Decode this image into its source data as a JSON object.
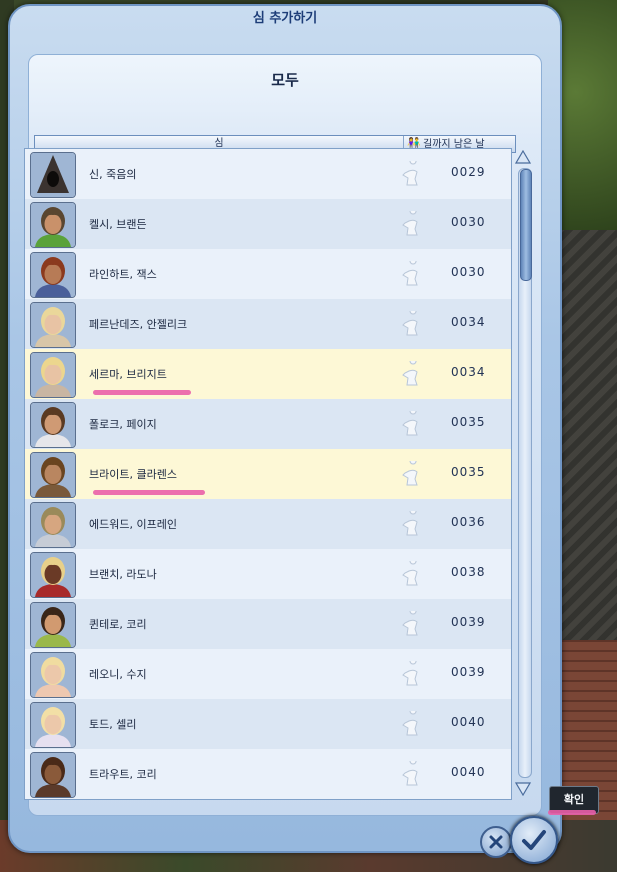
{
  "window": {
    "title": "심 추가하기"
  },
  "header": {
    "title": "모두"
  },
  "columns": {
    "sim": "심",
    "days_left": "길까지 남은 날"
  },
  "rows": [
    {
      "name": "신, 죽음의",
      "days": "0029",
      "highlighted": false,
      "skin": "#2b2220",
      "hair": "#3a2a22",
      "shirt": "#3b3330",
      "hooded": true
    },
    {
      "name": "켈시, 브랜든",
      "days": "0030",
      "highlighted": false,
      "skin": "#c9916a",
      "hair": "#5a4630",
      "shirt": "#5aa23a"
    },
    {
      "name": "라인하트, 잭스",
      "days": "0030",
      "highlighted": false,
      "skin": "#b77b56",
      "hair": "#8b3a1e",
      "shirt": "#4a5f9a"
    },
    {
      "name": "페르난데즈, 안젤리크",
      "days": "0034",
      "highlighted": false,
      "skin": "#e8c3a4",
      "hair": "#ead79a",
      "shirt": "#d8c6a8"
    },
    {
      "name": "세르마, 브리지트",
      "days": "0034",
      "highlighted": true,
      "skin": "#e8c3a4",
      "hair": "#ecd68e",
      "shirt": "#c9b6a2"
    },
    {
      "name": "폴로크, 페이지",
      "days": "0035",
      "highlighted": false,
      "skin": "#cf9a74",
      "hair": "#5a3a22",
      "shirt": "#e6e6ea"
    },
    {
      "name": "브라이트, 클라렌스",
      "days": "0035",
      "highlighted": true,
      "skin": "#b98660",
      "hair": "#6a4520",
      "shirt": "#7a5a3a"
    },
    {
      "name": "에드워드, 이프레인",
      "days": "0036",
      "highlighted": false,
      "skin": "#d6a680",
      "hair": "#9a8a5a",
      "shirt": "#c6ccd6"
    },
    {
      "name": "브랜치, 라도나",
      "days": "0038",
      "highlighted": false,
      "skin": "#6a3a26",
      "hair": "#e8d08a",
      "shirt": "#a82a2a"
    },
    {
      "name": "퀸테로, 코리",
      "days": "0039",
      "highlighted": false,
      "skin": "#d19a70",
      "hair": "#3a2618",
      "shirt": "#9ab84a"
    },
    {
      "name": "레오니, 수지",
      "days": "0039",
      "highlighted": false,
      "skin": "#ecc8aa",
      "hair": "#f0dca0",
      "shirt": "#eec8b0"
    },
    {
      "name": "토드, 셀리",
      "days": "0040",
      "highlighted": false,
      "skin": "#ecc8aa",
      "hair": "#f2dfa6",
      "shirt": "#e6e0f0"
    },
    {
      "name": "트라우트, 코리",
      "days": "0040",
      "highlighted": false,
      "skin": "#8a5a3a",
      "hair": "#4a2a18",
      "shirt": "#5a3a2a"
    }
  ],
  "buttons": {
    "confirm_tooltip": "확인"
  },
  "icons": {
    "age": "baby-silhouette-icon",
    "couple": "couple-icon",
    "cancel": "close-icon",
    "ok": "checkmark-icon"
  },
  "colors": {
    "accent": "#1d3d78",
    "highlight_row": "#fdf8d6",
    "mark": "#ea5fa8"
  }
}
